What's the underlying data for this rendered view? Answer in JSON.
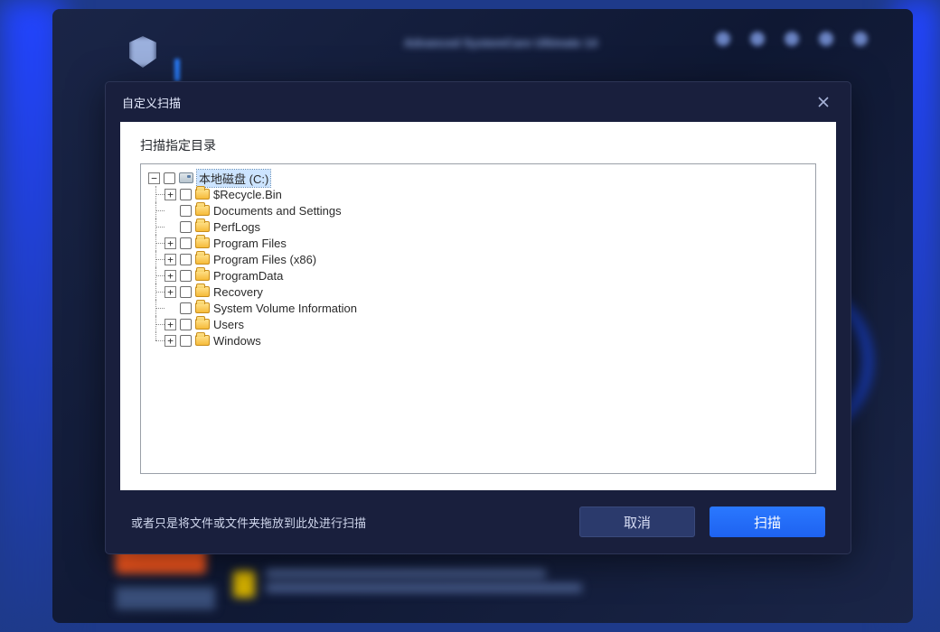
{
  "bg": {
    "title": "Advanced SystemCare Ultimate 14"
  },
  "modal": {
    "title": "自定义扫描",
    "section_label": "扫描指定目录",
    "hint": "或者只是将文件或文件夹拖放到此处进行扫描",
    "buttons": {
      "cancel": "取消",
      "scan": "扫描"
    },
    "tree": {
      "root_label": "本地磁盘 (C:)",
      "children": [
        {
          "label": "$Recycle.Bin",
          "expandable": true
        },
        {
          "label": "Documents and Settings",
          "expandable": false
        },
        {
          "label": "PerfLogs",
          "expandable": false
        },
        {
          "label": "Program Files",
          "expandable": true
        },
        {
          "label": "Program Files (x86)",
          "expandable": true
        },
        {
          "label": "ProgramData",
          "expandable": true
        },
        {
          "label": "Recovery",
          "expandable": true
        },
        {
          "label": "System Volume Information",
          "expandable": false
        },
        {
          "label": "Users",
          "expandable": true
        },
        {
          "label": "Windows",
          "expandable": true
        }
      ]
    }
  }
}
